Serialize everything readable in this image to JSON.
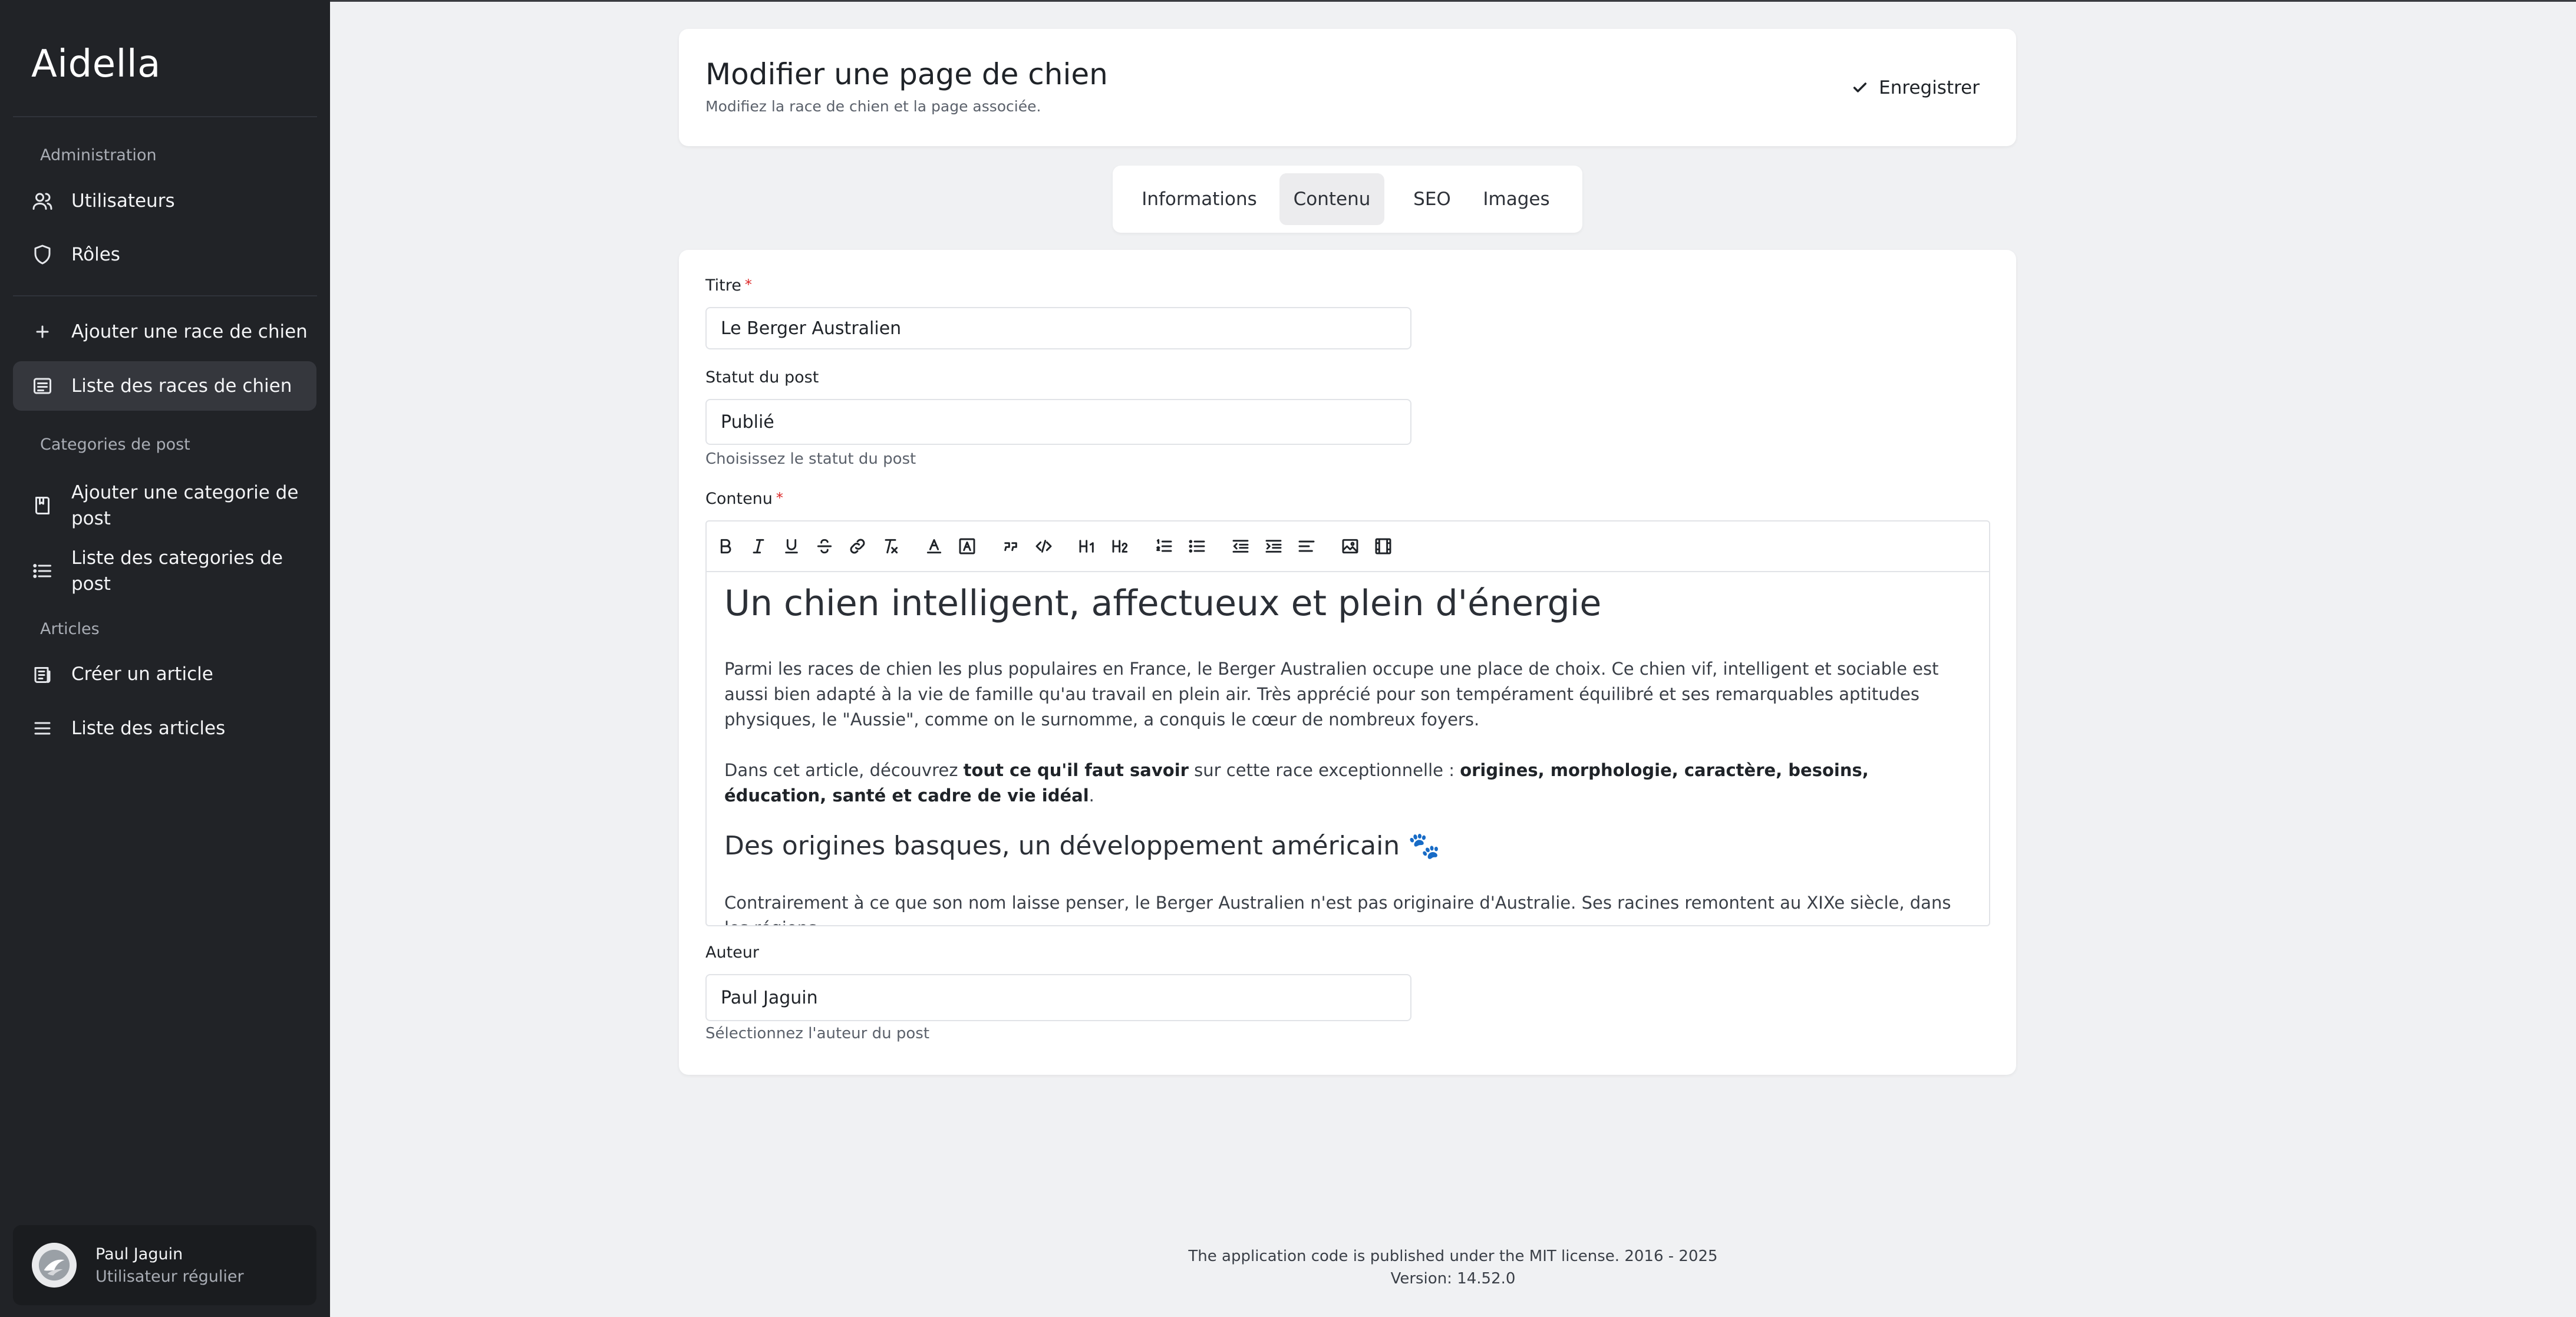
{
  "app": {
    "brand": "Aidella"
  },
  "sidebar": {
    "sections": {
      "administration": "Administration",
      "categories": "Categories de post",
      "articles": "Articles"
    },
    "items": {
      "users": "Utilisateurs",
      "roles": "Rôles",
      "add_breed": "Ajouter une race de chien",
      "list_breeds": "Liste des races de chien",
      "add_category": "Ajouter une categorie de post",
      "list_categories": "Liste des categories de post",
      "create_article": "Créer un article",
      "list_articles": "Liste des articles"
    },
    "user": {
      "name": "Paul Jaguin",
      "role": "Utilisateur régulier"
    }
  },
  "header": {
    "title": "Modifier une page de chien",
    "subtitle": "Modifiez la race de chien et la page associée.",
    "save_label": "Enregistrer"
  },
  "tabs": [
    "Informations",
    "Contenu",
    "SEO",
    "Images"
  ],
  "active_tab": "Contenu",
  "form": {
    "title_label": "Titre",
    "title_value": "Le Berger Australien",
    "status_label": "Statut du post",
    "status_value": "Publié",
    "status_help": "Choisissez le statut du post",
    "content_label": "Contenu",
    "author_label": "Auteur",
    "author_value": "Paul Jaguin",
    "author_help": "Sélectionnez l'auteur du post",
    "required_mark": "*"
  },
  "editor": {
    "toolbar": [
      "bold",
      "italic",
      "underline",
      "strike",
      "link",
      "clear-format",
      "text-color",
      "background-color",
      "blockquote",
      "code",
      "heading-1",
      "heading-2",
      "ordered-list",
      "bullet-list",
      "outdent",
      "indent",
      "align-left",
      "image",
      "video"
    ],
    "h1": "Un chien intelligent, affectueux et plein d'énergie",
    "p1": "Parmi les races de chien les plus populaires en France, le Berger Australien occupe une place de choix. Ce chien vif, intelligent et sociable est aussi bien adapté à la vie de famille qu'au travail en plein air. Très apprécié pour son tempérament équilibré et ses remarquables aptitudes physiques, le \"Aussie\", comme on le surnomme, a conquis le cœur de nombreux foyers.",
    "p2_start": "Dans cet article, découvrez ",
    "p2_bold1": "tout ce qu'il faut savoir",
    "p2_mid": " sur cette race exceptionnelle : ",
    "p2_bold2": "origines, morphologie, caractère, besoins, éducation, santé et cadre de vie idéal",
    "p2_end": ".",
    "h2": "Des origines basques, un développement américain 🐾",
    "p3": "Contrairement à ce que son nom laisse penser, le Berger Australien n'est pas originaire d'Australie. Ses racines remontent au XIXe siècle, dans les régions"
  },
  "footer": {
    "license": "The application code is published under the MIT license. 2016 - 2025",
    "version": "Version: 14.52.0"
  },
  "colors": {
    "sidebar_bg": "#212327",
    "page_bg": "#f0f1f3",
    "required": "#dc2626"
  }
}
